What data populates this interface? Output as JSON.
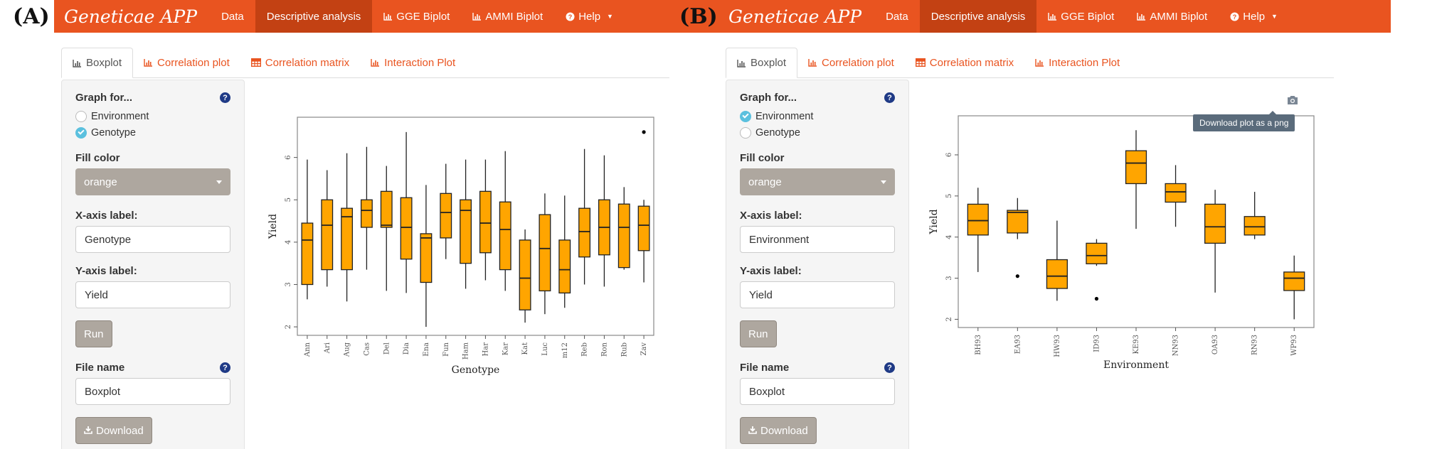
{
  "panels": [
    {
      "letter": "(A)",
      "brand": "Geneticae APP",
      "nav": [
        {
          "label": "Data",
          "icon": ""
        },
        {
          "label": "Descriptive analysis",
          "icon": "",
          "active": true
        },
        {
          "label": "GGE Biplot",
          "icon": "bar-chart-icon"
        },
        {
          "label": "AMMI Biplot",
          "icon": "bar-chart-icon"
        },
        {
          "label": "Help",
          "icon": "question-circle-icon"
        }
      ],
      "tabs": [
        {
          "label": "Boxplot",
          "icon": "bar-chart-icon",
          "active": true
        },
        {
          "label": "Correlation plot",
          "icon": "bar-chart-icon"
        },
        {
          "label": "Correlation matrix",
          "icon": "table-icon"
        },
        {
          "label": "Interaction Plot",
          "icon": "bar-chart-icon"
        }
      ],
      "sidebar": {
        "graph_for_label": "Graph for...",
        "options": [
          "Environment",
          "Genotype"
        ],
        "selected": "Genotype",
        "fill_label": "Fill color",
        "fill_value": "orange",
        "xlabel_label": "X-axis label:",
        "xlabel_value": "Genotype",
        "ylabel_label": "Y-axis label:",
        "ylabel_value": "Yield",
        "run_label": "Run",
        "filename_label": "File name",
        "filename_value": "Boxplot",
        "download_label": "Download"
      },
      "chart_data": {
        "type": "boxplot",
        "xlabel": "Genotype",
        "ylabel": "Yield",
        "ylim": [
          1.8,
          6.95
        ],
        "yticks": [
          2,
          3,
          4,
          5,
          6
        ],
        "fill": "#FFA500",
        "categories": [
          "Ann",
          "Ari",
          "Aug",
          "Cas",
          "Del",
          "Dia",
          "Ena",
          "Fun",
          "Ham",
          "Har",
          "Kar",
          "Kat",
          "Luc",
          "m12",
          "Reb",
          "Ron",
          "Rub",
          "Zav"
        ],
        "boxes": [
          {
            "min": 2.65,
            "q1": 3.0,
            "median": 4.05,
            "q3": 4.45,
            "max": 5.95
          },
          {
            "min": 2.95,
            "q1": 3.35,
            "median": 4.4,
            "q3": 5.0,
            "max": 5.7
          },
          {
            "min": 2.6,
            "q1": 3.35,
            "median": 4.6,
            "q3": 4.8,
            "max": 6.1
          },
          {
            "min": 3.35,
            "q1": 4.35,
            "median": 4.75,
            "q3": 5.0,
            "max": 6.25
          },
          {
            "min": 2.85,
            "q1": 4.35,
            "median": 4.4,
            "q3": 5.2,
            "max": 5.8
          },
          {
            "min": 2.8,
            "q1": 3.6,
            "median": 4.35,
            "q3": 5.05,
            "max": 6.6
          },
          {
            "min": 2.0,
            "q1": 3.05,
            "median": 4.1,
            "q3": 4.2,
            "max": 5.35
          },
          {
            "min": 3.6,
            "q1": 4.1,
            "median": 4.7,
            "q3": 5.15,
            "max": 5.85
          },
          {
            "min": 2.9,
            "q1": 3.5,
            "median": 4.75,
            "q3": 5.0,
            "max": 5.95
          },
          {
            "min": 3.1,
            "q1": 3.75,
            "median": 4.45,
            "q3": 5.2,
            "max": 5.95
          },
          {
            "min": 2.85,
            "q1": 3.35,
            "median": 4.3,
            "q3": 4.95,
            "max": 6.15
          },
          {
            "min": 2.1,
            "q1": 2.4,
            "median": 3.15,
            "q3": 4.05,
            "max": 4.3
          },
          {
            "min": 2.3,
            "q1": 2.85,
            "median": 3.85,
            "q3": 4.65,
            "max": 5.15
          },
          {
            "min": 2.45,
            "q1": 2.8,
            "median": 3.35,
            "q3": 4.05,
            "max": 5.1
          },
          {
            "min": 3.0,
            "q1": 3.65,
            "median": 4.25,
            "q3": 4.8,
            "max": 6.2
          },
          {
            "min": 2.95,
            "q1": 3.7,
            "median": 4.35,
            "q3": 5.0,
            "max": 6.05
          },
          {
            "min": 3.35,
            "q1": 3.4,
            "median": 4.35,
            "q3": 4.9,
            "max": 5.3
          },
          {
            "min": 3.05,
            "q1": 3.8,
            "median": 4.4,
            "q3": 4.85,
            "max": 5.0,
            "outliers": [
              6.6
            ]
          }
        ]
      }
    },
    {
      "letter": "(B)",
      "brand": "Geneticae APP",
      "nav": [
        {
          "label": "Data",
          "icon": ""
        },
        {
          "label": "Descriptive analysis",
          "icon": "",
          "active": true
        },
        {
          "label": "GGE Biplot",
          "icon": "bar-chart-icon"
        },
        {
          "label": "AMMI Biplot",
          "icon": "bar-chart-icon"
        },
        {
          "label": "Help",
          "icon": "question-circle-icon"
        }
      ],
      "tabs": [
        {
          "label": "Boxplot",
          "icon": "bar-chart-icon",
          "active": true
        },
        {
          "label": "Correlation plot",
          "icon": "bar-chart-icon"
        },
        {
          "label": "Correlation matrix",
          "icon": "table-icon"
        },
        {
          "label": "Interaction Plot",
          "icon": "bar-chart-icon"
        }
      ],
      "sidebar": {
        "graph_for_label": "Graph for...",
        "options": [
          "Environment",
          "Genotype"
        ],
        "selected": "Environment",
        "fill_label": "Fill color",
        "fill_value": "orange",
        "xlabel_label": "X-axis label:",
        "xlabel_value": "Environment",
        "ylabel_label": "Y-axis label:",
        "ylabel_value": "Yield",
        "run_label": "Run",
        "filename_label": "File name",
        "filename_value": "Boxplot",
        "download_label": "Download"
      },
      "tooltip": "Download plot as a png",
      "chart_data": {
        "type": "boxplot",
        "xlabel": "Environment",
        "ylabel": "Yield",
        "ylim": [
          1.8,
          6.95
        ],
        "yticks": [
          2,
          3,
          4,
          5,
          6
        ],
        "fill": "#FFA500",
        "categories": [
          "BH93",
          "EA93",
          "HW93",
          "ID93",
          "KE93",
          "NN93",
          "OA93",
          "RN93",
          "WP93"
        ],
        "boxes": [
          {
            "min": 3.15,
            "q1": 4.05,
            "median": 4.4,
            "q3": 4.8,
            "max": 5.2
          },
          {
            "min": 3.95,
            "q1": 4.1,
            "median": 4.6,
            "q3": 4.65,
            "max": 4.95,
            "outliers": [
              3.05
            ]
          },
          {
            "min": 2.45,
            "q1": 2.75,
            "median": 3.05,
            "q3": 3.45,
            "max": 4.4
          },
          {
            "min": 3.3,
            "q1": 3.35,
            "median": 3.55,
            "q3": 3.85,
            "max": 3.95,
            "outliers": [
              2.5
            ]
          },
          {
            "min": 4.2,
            "q1": 5.3,
            "median": 5.8,
            "q3": 6.1,
            "max": 6.6
          },
          {
            "min": 4.25,
            "q1": 4.85,
            "median": 5.1,
            "q3": 5.3,
            "max": 5.75
          },
          {
            "min": 2.65,
            "q1": 3.85,
            "median": 4.25,
            "q3": 4.8,
            "max": 5.15
          },
          {
            "min": 3.95,
            "q1": 4.05,
            "median": 4.25,
            "q3": 4.5,
            "max": 5.1
          },
          {
            "min": 2.0,
            "q1": 2.7,
            "median": 3.0,
            "q3": 3.15,
            "max": 3.55
          }
        ]
      }
    }
  ]
}
